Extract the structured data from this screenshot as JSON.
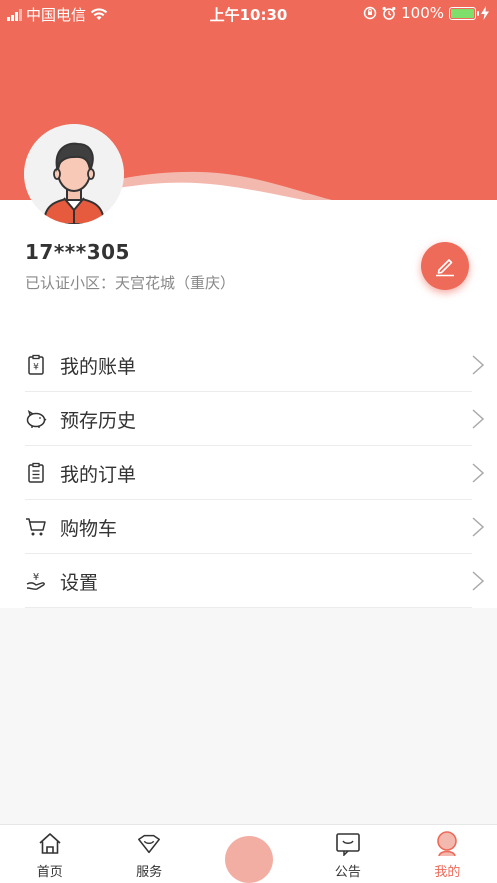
{
  "status_bar": {
    "carrier": "中国电信",
    "time": "上午10:30",
    "battery": "100%"
  },
  "user": {
    "phone": "17***305",
    "community": "已认证小区：天宫花城（重庆）"
  },
  "menu": {
    "items": [
      {
        "label": "我的账单",
        "icon": "bill-icon"
      },
      {
        "label": "预存历史",
        "icon": "piggy-bank-icon"
      },
      {
        "label": "我的订单",
        "icon": "clipboard-icon"
      },
      {
        "label": "购物车",
        "icon": "cart-icon"
      },
      {
        "label": "设置",
        "icon": "settings-icon"
      }
    ]
  },
  "tab_bar": {
    "tabs": [
      {
        "label": "首页",
        "icon": "home-icon"
      },
      {
        "label": "服务",
        "icon": "service-icon"
      },
      {
        "label": "",
        "icon": "center-button"
      },
      {
        "label": "公告",
        "icon": "notice-icon"
      },
      {
        "label": "我的",
        "icon": "profile-icon",
        "active": true
      }
    ]
  },
  "colors": {
    "accent": "#ee6a59",
    "header_top": "#ef6a58",
    "wave_light": "#f4b9ae",
    "text": "#333333",
    "subtext": "#888888"
  }
}
